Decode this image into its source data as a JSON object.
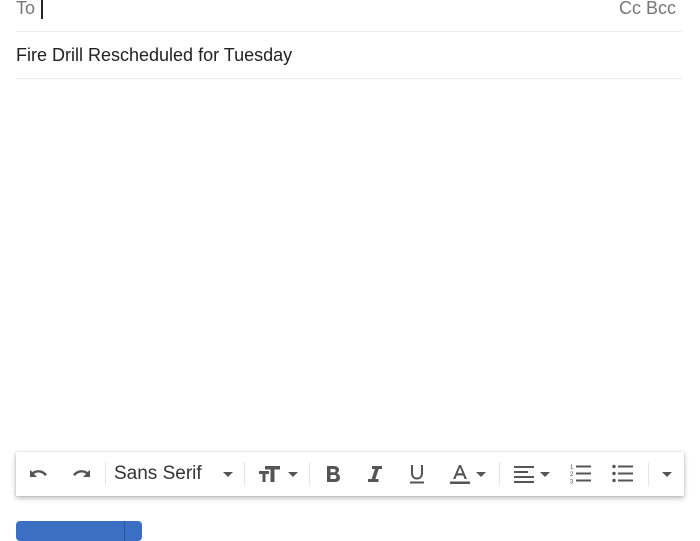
{
  "compose": {
    "to_label": "To",
    "to_value": "",
    "cc_label": "Cc",
    "bcc_label": "Bcc",
    "subject": "Fire Drill Rescheduled for Tuesday",
    "body": ""
  },
  "toolbar": {
    "undo": "undo-icon",
    "redo": "redo-icon",
    "font_family": "Sans Serif",
    "font_size": "text-size-icon",
    "bold": "bold-icon",
    "italic": "italic-icon",
    "underline": "underline-icon",
    "text_color": "text-color-icon",
    "align": "align-left-icon",
    "numbered_list": "numbered-list-icon",
    "bulleted_list": "bulleted-list-icon",
    "more": "more-formatting-options"
  },
  "colors": {
    "send_button": "#3b6fc3",
    "icon": "#555555"
  }
}
